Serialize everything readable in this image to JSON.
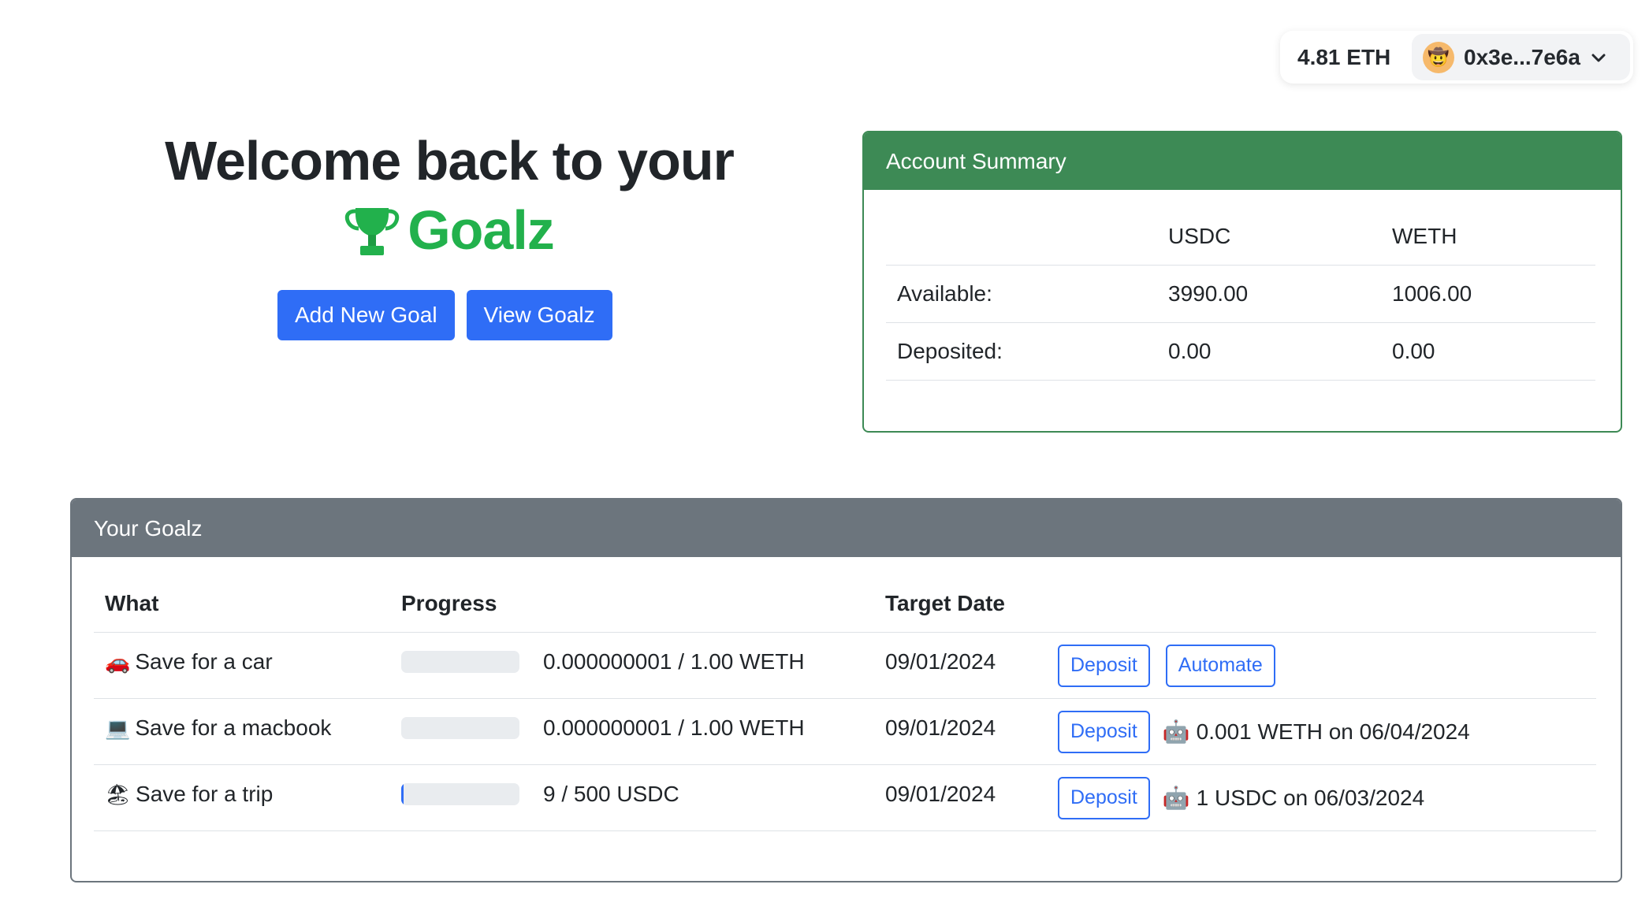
{
  "wallet": {
    "balance": "4.81 ETH",
    "address": "0x3e...7e6a",
    "avatar_icon": "face-emoji-icon"
  },
  "hero": {
    "line1": "Welcome back to your",
    "brand": "Goalz",
    "brand_color": "#22b14c",
    "add_goal_label": "Add New Goal",
    "view_goalz_label": "View Goalz"
  },
  "summary": {
    "title": "Account Summary",
    "headers": [
      "",
      "USDC",
      "WETH"
    ],
    "rows": [
      {
        "label": "Available:",
        "usdc": "3990.00",
        "weth": "1006.00"
      },
      {
        "label": "Deposited:",
        "usdc": "0.00",
        "weth": "0.00"
      }
    ]
  },
  "goalz": {
    "title": "Your Goalz",
    "headers": {
      "what": "What",
      "progress": "Progress",
      "target_date": "Target Date"
    },
    "rows": [
      {
        "emoji": "🚗",
        "what": "Save for a car",
        "progress_fraction": 1e-09,
        "progress_text": "0.000000001 / 1.00 WETH",
        "target_date": "09/01/2024",
        "deposit_label": "Deposit",
        "automate_label": "Automate",
        "automation": ""
      },
      {
        "emoji": "💻",
        "what": "Save for a macbook",
        "progress_fraction": 1e-09,
        "progress_text": "0.000000001 / 1.00 WETH",
        "target_date": "09/01/2024",
        "deposit_label": "Deposit",
        "automate_label": "",
        "automation": "0.001 WETH on 06/04/2024"
      },
      {
        "emoji": "🏖",
        "what": "Save for a trip",
        "progress_fraction": 0.018,
        "progress_text": "9 / 500 USDC",
        "target_date": "09/01/2024",
        "deposit_label": "Deposit",
        "automate_label": "",
        "automation": "1 USDC on 06/03/2024"
      }
    ]
  },
  "colors": {
    "primary": "#2f6df6",
    "success_header": "#3d8a55",
    "secondary_header": "#6c757d"
  }
}
